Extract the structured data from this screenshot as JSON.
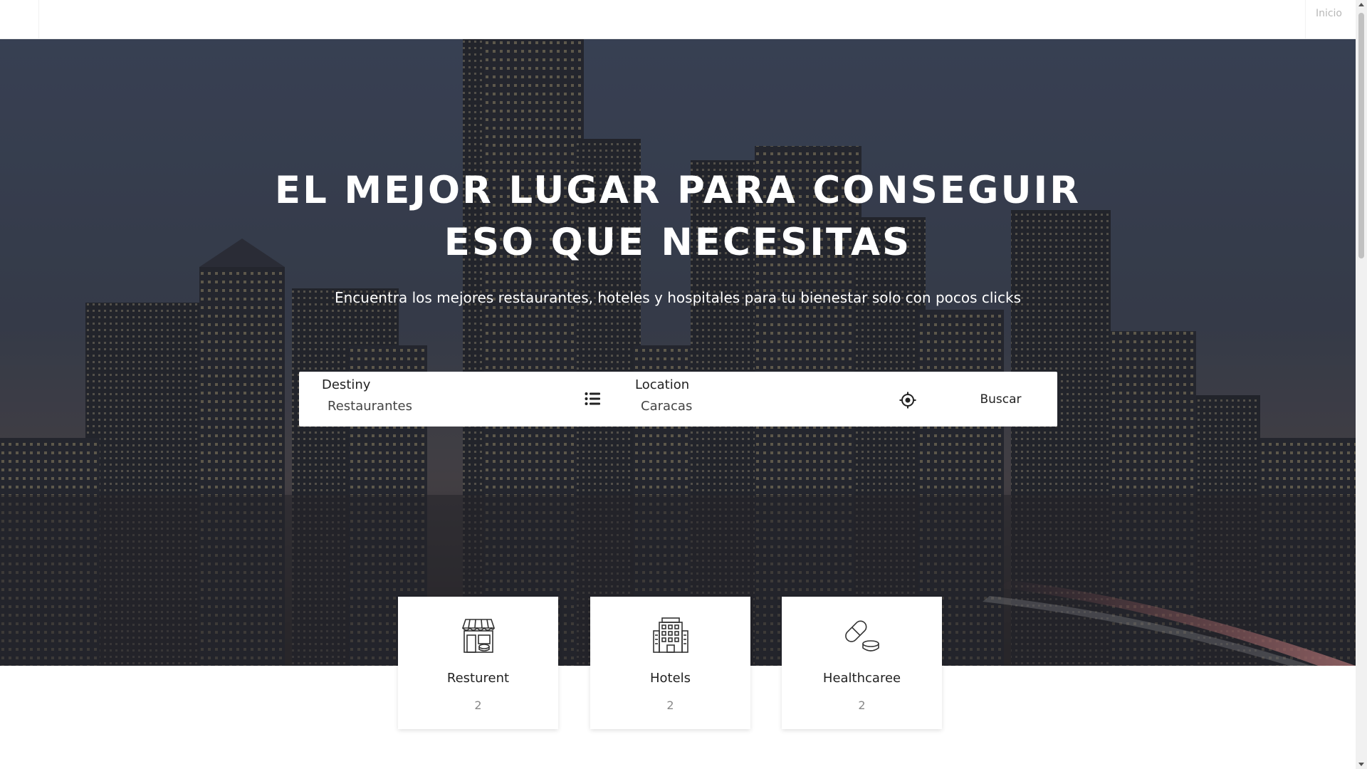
{
  "nav": {
    "link_inicio": "Inicio"
  },
  "hero": {
    "title_line1": "EL MEJOR LUGAR PARA CONSEGUIR",
    "title_line2": "ESO QUE NECESITAS",
    "subtitle": "Encuentra los mejores restaurantes, hoteles y hospitales para tu bienestar solo con pocos clicks"
  },
  "search": {
    "destiny_label": "Destiny",
    "destiny_value": "Restaurantes",
    "location_label": "Location",
    "location_value": "Caracas",
    "button_label": "Buscar",
    "destiny_icon": "list-icon",
    "location_icon": "target-icon"
  },
  "categories": [
    {
      "name": "Resturent",
      "count": "2",
      "icon": "store-icon"
    },
    {
      "name": "Hotels",
      "count": "2",
      "icon": "hotel-building-icon"
    },
    {
      "name": "Healthcaree",
      "count": "2",
      "icon": "pill-icon"
    }
  ],
  "colors": {
    "text_dark": "#222222",
    "nav_link": "#b7b7b7",
    "count_gray": "#888888"
  }
}
